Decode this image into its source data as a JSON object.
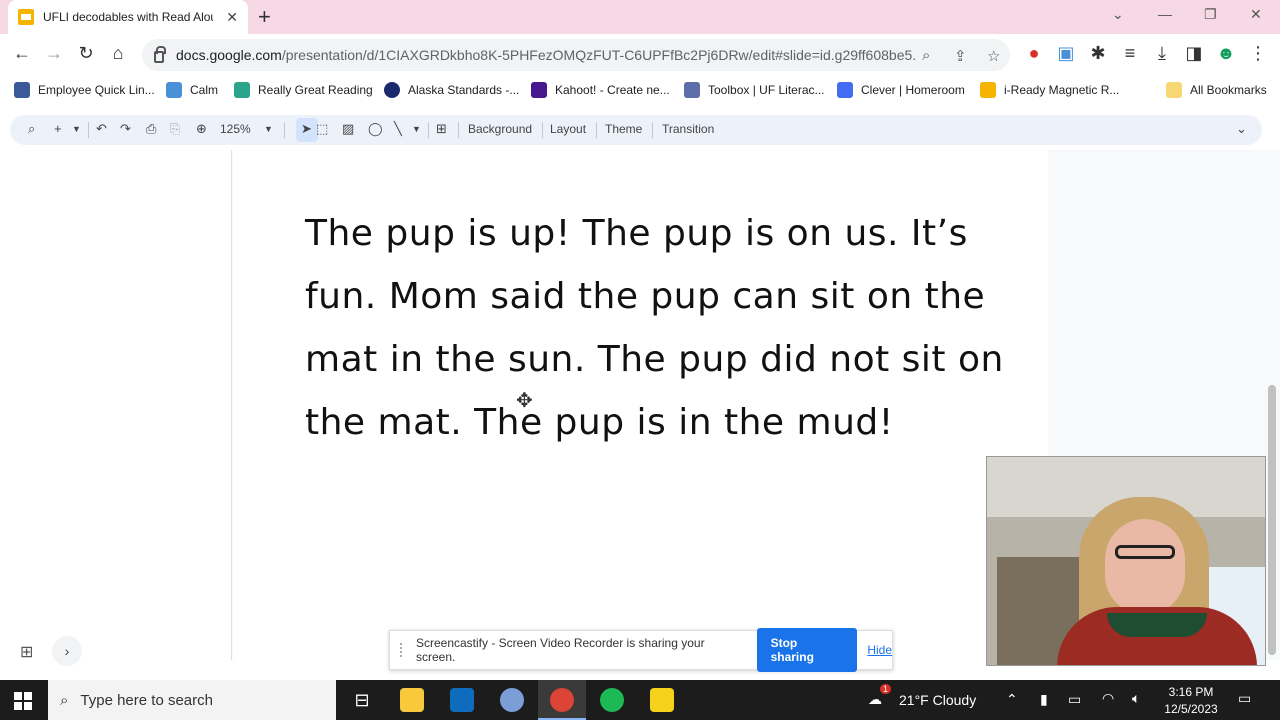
{
  "browser": {
    "tab_title": "UFLI decodables with Read Alou",
    "url_host": "docs.google.com",
    "url_path": "/presentation/d/1CIAXGRDkbho8K-5PHFezOMQzFUT-C6UPFfBc2Pj6DRw/edit#slide=id.g29ff608be5..."
  },
  "bookmarks": [
    {
      "label": "Employee Quick Lin...",
      "color": "#3b5998"
    },
    {
      "label": "Calm",
      "color": "#4a90d9"
    },
    {
      "label": "Really Great Reading",
      "color": "#2aa58c"
    },
    {
      "label": "Alaska Standards -...",
      "color": "#1a2a6c"
    },
    {
      "label": "Kahoot! - Create ne...",
      "color": "#46178f"
    },
    {
      "label": "Toolbox | UF Literac...",
      "color": "#5b6ea8"
    },
    {
      "label": "Clever | Homeroom",
      "color": "#436cf2"
    },
    {
      "label": "i-Ready Magnetic R...",
      "color": "#f4b400"
    }
  ],
  "all_bookmarks": "All Bookmarks",
  "slides_toolbar": {
    "zoom": "125%",
    "background": "Background",
    "layout": "Layout",
    "theme": "Theme",
    "transition": "Transition"
  },
  "slide": {
    "lines": [
      "The pup is up! The pup is on us. It’s",
      "fun. Mom said the pup can sit on the",
      "mat in the sun. The pup did not sit on",
      "the mat. The pup is in the mud!"
    ]
  },
  "share_bar": {
    "message": "Screencastify - Screen Video Recorder is sharing your screen.",
    "stop": "Stop sharing",
    "hide": "Hide"
  },
  "taskbar": {
    "search_placeholder": "Type here to search",
    "weather": "21°F  Cloudy",
    "notification_count": "1",
    "time": "3:16 PM",
    "date": "12/5/2023"
  }
}
